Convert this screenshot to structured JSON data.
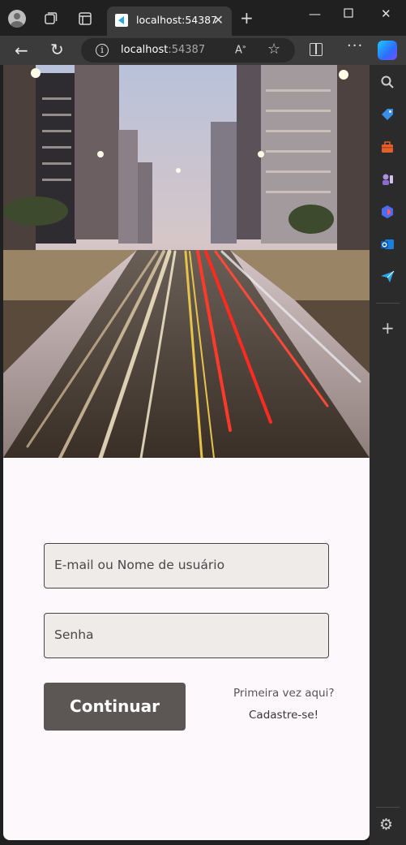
{
  "browser": {
    "tab": {
      "title": "localhost:54387"
    },
    "address": {
      "host": "localhost",
      "port": ":54387"
    },
    "icons": {
      "tab_actions": "tab-actions-icon",
      "vertical_tabs": "vertical-tabs-icon",
      "new_tab": "plus-icon",
      "minimize": "minimize-icon",
      "maximize": "maximize-icon",
      "close": "close-icon",
      "back": "back-arrow-icon",
      "reload": "reload-icon",
      "info": "info-icon",
      "read_aloud": "read-aloud-icon",
      "favorite": "star-icon",
      "split_screen": "split-screen-icon",
      "more": "more-icon",
      "copilot": "copilot-icon"
    },
    "sidebar": {
      "items": [
        "search-icon",
        "shopping-tag-icon",
        "toolbox-icon",
        "games-icon",
        "office-icon",
        "outlook-icon",
        "send-icon"
      ],
      "add_icon": "plus-icon",
      "settings_icon": "gear-icon"
    }
  },
  "login": {
    "hero_image": "city-street-long-exposure-image",
    "email_label": "E-mail ou Nome de usuário",
    "password_label": "Senha",
    "continue_label": "Continuar",
    "first_time_text": "Primeira vez aqui?",
    "signup_link": "Cadastre-se!"
  },
  "colors": {
    "button": "#5c5655",
    "field_bg": "#efebe9",
    "page_bg": "#fdf8fb"
  }
}
